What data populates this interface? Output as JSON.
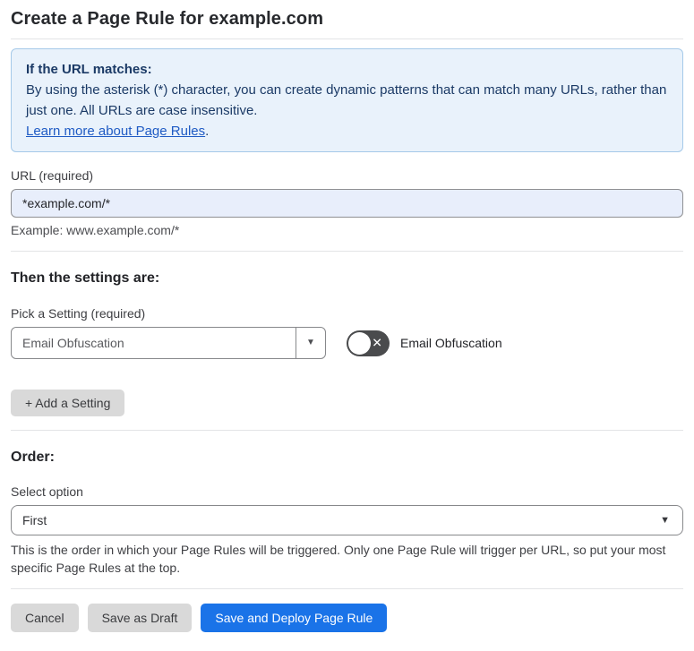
{
  "page": {
    "title": "Create a Page Rule for example.com"
  },
  "info_box": {
    "heading": "If the URL matches:",
    "body": "By using the asterisk (*) character, you can create dynamic patterns that can match many URLs, rather than just one. All URLs are case insensitive.",
    "link_label": "Learn more about Page Rules",
    "link_suffix": "."
  },
  "url_field": {
    "label": "URL (required)",
    "value": "*example.com/*",
    "helper": "Example: www.example.com/*"
  },
  "settings_section": {
    "heading": "Then the settings are:",
    "picker_label": "Pick a Setting (required)",
    "picker_value": "Email Obfuscation",
    "toggle_label": "Email Obfuscation",
    "toggle_state": "off",
    "toggle_glyph": "✕",
    "caret_glyph": "▼",
    "add_button_label": "+ Add a Setting"
  },
  "order_section": {
    "heading": "Order:",
    "select_label": "Select option",
    "select_value": "First",
    "caret_glyph": "▼",
    "helper": "This is the order in which your Page Rules will be triggered. Only one Page Rule will trigger per URL, so put your most specific Page Rules at the top."
  },
  "footer": {
    "cancel_label": "Cancel",
    "save_draft_label": "Save as Draft",
    "save_deploy_label": "Save and Deploy Page Rule"
  },
  "colors": {
    "primary_blue": "#1a73e8",
    "info_bg": "#e9f2fb",
    "info_border": "#a5c9e9",
    "info_text": "#1b3a66",
    "link_blue": "#1f5bc4",
    "input_highlight_bg": "#e8eefb",
    "gray_button_bg": "#d9d9d9",
    "toggle_off_bg": "#4a4b4d"
  }
}
